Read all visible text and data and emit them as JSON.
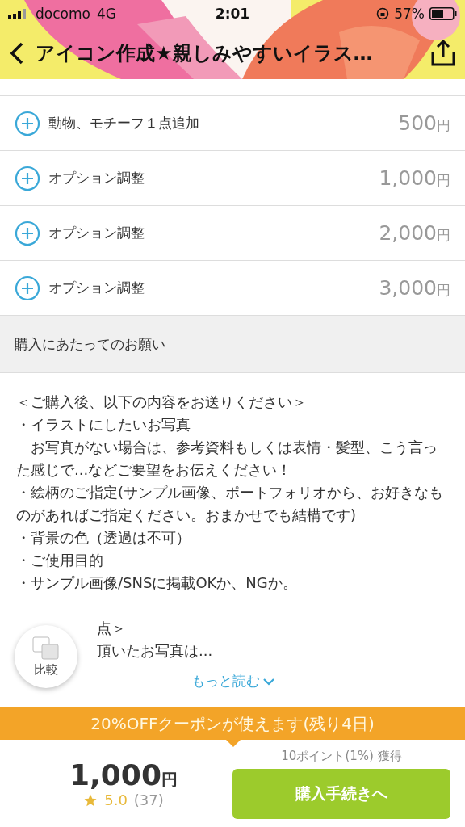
{
  "status_bar": {
    "carrier": "docomo",
    "network": "4G",
    "time": "2:01",
    "battery": "57%"
  },
  "nav": {
    "title": "アイコン作成★親しみやすいイラス…"
  },
  "options": [
    {
      "label": "動物、モチーフ１点追加",
      "price": "500",
      "unit": "円"
    },
    {
      "label": "オプション調整",
      "price": "1,000",
      "unit": "円"
    },
    {
      "label": "オプション調整",
      "price": "2,000",
      "unit": "円"
    },
    {
      "label": "オプション調整",
      "price": "3,000",
      "unit": "円"
    }
  ],
  "section": {
    "title": "購入にあたってのお願い"
  },
  "description": [
    {
      "kind": "line",
      "text": "＜ご購入後、以下の内容をお送りください＞"
    },
    {
      "kind": "line",
      "text": "・イラストにしたいお写真"
    },
    {
      "kind": "line",
      "text": "　お写真がない場合は、参考資料もしくは表情・髪型、こう言った感じで...などご要望をお伝えください！"
    },
    {
      "kind": "line",
      "text": "・絵柄のご指定(サンプル画像、ポートフォリオから、お好きなものがあればご指定ください。おまかせでも結構です)"
    },
    {
      "kind": "line",
      "text": "・背景の色（透過は不可）"
    },
    {
      "kind": "line",
      "text": "・ご使用目的"
    },
    {
      "kind": "line",
      "text": "・サンプル画像/SNSに掲載OKか、NGか。"
    },
    {
      "kind": "blank"
    },
    {
      "kind": "partial",
      "text": "点＞"
    },
    {
      "kind": "partial",
      "text": "頂いたお写真は..."
    }
  ],
  "compare": {
    "label": "比較"
  },
  "read_more": {
    "label": "もっと読む"
  },
  "coupon": {
    "text": "20%OFFクーポンが使えます(残り4日)"
  },
  "footer": {
    "price": "1,000",
    "unit": "円",
    "rating": "5.0",
    "reviews": "(37)",
    "points": "10ポイント(1%) 獲得",
    "buy_button": "購入手続きへ"
  }
}
